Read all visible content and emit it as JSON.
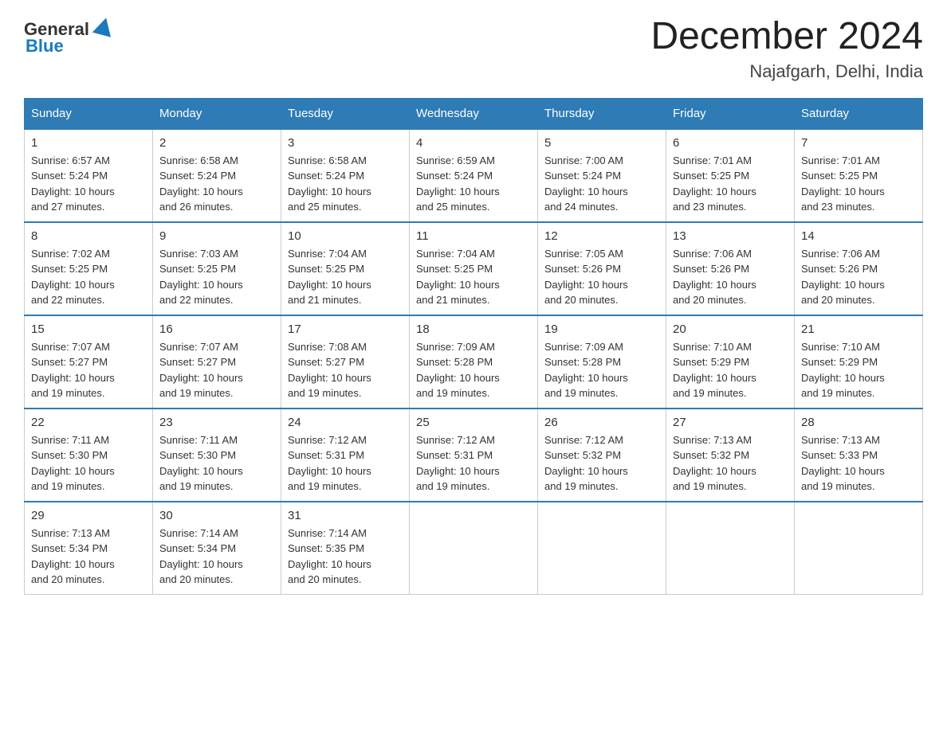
{
  "header": {
    "logo_general": "General",
    "logo_blue": "Blue",
    "month_title": "December 2024",
    "location": "Najafgarh, Delhi, India"
  },
  "days_of_week": [
    "Sunday",
    "Monday",
    "Tuesday",
    "Wednesday",
    "Thursday",
    "Friday",
    "Saturday"
  ],
  "weeks": [
    [
      {
        "num": "1",
        "sunrise": "6:57 AM",
        "sunset": "5:24 PM",
        "daylight": "10 hours and 27 minutes."
      },
      {
        "num": "2",
        "sunrise": "6:58 AM",
        "sunset": "5:24 PM",
        "daylight": "10 hours and 26 minutes."
      },
      {
        "num": "3",
        "sunrise": "6:58 AM",
        "sunset": "5:24 PM",
        "daylight": "10 hours and 25 minutes."
      },
      {
        "num": "4",
        "sunrise": "6:59 AM",
        "sunset": "5:24 PM",
        "daylight": "10 hours and 25 minutes."
      },
      {
        "num": "5",
        "sunrise": "7:00 AM",
        "sunset": "5:24 PM",
        "daylight": "10 hours and 24 minutes."
      },
      {
        "num": "6",
        "sunrise": "7:01 AM",
        "sunset": "5:25 PM",
        "daylight": "10 hours and 23 minutes."
      },
      {
        "num": "7",
        "sunrise": "7:01 AM",
        "sunset": "5:25 PM",
        "daylight": "10 hours and 23 minutes."
      }
    ],
    [
      {
        "num": "8",
        "sunrise": "7:02 AM",
        "sunset": "5:25 PM",
        "daylight": "10 hours and 22 minutes."
      },
      {
        "num": "9",
        "sunrise": "7:03 AM",
        "sunset": "5:25 PM",
        "daylight": "10 hours and 22 minutes."
      },
      {
        "num": "10",
        "sunrise": "7:04 AM",
        "sunset": "5:25 PM",
        "daylight": "10 hours and 21 minutes."
      },
      {
        "num": "11",
        "sunrise": "7:04 AM",
        "sunset": "5:25 PM",
        "daylight": "10 hours and 21 minutes."
      },
      {
        "num": "12",
        "sunrise": "7:05 AM",
        "sunset": "5:26 PM",
        "daylight": "10 hours and 20 minutes."
      },
      {
        "num": "13",
        "sunrise": "7:06 AM",
        "sunset": "5:26 PM",
        "daylight": "10 hours and 20 minutes."
      },
      {
        "num": "14",
        "sunrise": "7:06 AM",
        "sunset": "5:26 PM",
        "daylight": "10 hours and 20 minutes."
      }
    ],
    [
      {
        "num": "15",
        "sunrise": "7:07 AM",
        "sunset": "5:27 PM",
        "daylight": "10 hours and 19 minutes."
      },
      {
        "num": "16",
        "sunrise": "7:07 AM",
        "sunset": "5:27 PM",
        "daylight": "10 hours and 19 minutes."
      },
      {
        "num": "17",
        "sunrise": "7:08 AM",
        "sunset": "5:27 PM",
        "daylight": "10 hours and 19 minutes."
      },
      {
        "num": "18",
        "sunrise": "7:09 AM",
        "sunset": "5:28 PM",
        "daylight": "10 hours and 19 minutes."
      },
      {
        "num": "19",
        "sunrise": "7:09 AM",
        "sunset": "5:28 PM",
        "daylight": "10 hours and 19 minutes."
      },
      {
        "num": "20",
        "sunrise": "7:10 AM",
        "sunset": "5:29 PM",
        "daylight": "10 hours and 19 minutes."
      },
      {
        "num": "21",
        "sunrise": "7:10 AM",
        "sunset": "5:29 PM",
        "daylight": "10 hours and 19 minutes."
      }
    ],
    [
      {
        "num": "22",
        "sunrise": "7:11 AM",
        "sunset": "5:30 PM",
        "daylight": "10 hours and 19 minutes."
      },
      {
        "num": "23",
        "sunrise": "7:11 AM",
        "sunset": "5:30 PM",
        "daylight": "10 hours and 19 minutes."
      },
      {
        "num": "24",
        "sunrise": "7:12 AM",
        "sunset": "5:31 PM",
        "daylight": "10 hours and 19 minutes."
      },
      {
        "num": "25",
        "sunrise": "7:12 AM",
        "sunset": "5:31 PM",
        "daylight": "10 hours and 19 minutes."
      },
      {
        "num": "26",
        "sunrise": "7:12 AM",
        "sunset": "5:32 PM",
        "daylight": "10 hours and 19 minutes."
      },
      {
        "num": "27",
        "sunrise": "7:13 AM",
        "sunset": "5:32 PM",
        "daylight": "10 hours and 19 minutes."
      },
      {
        "num": "28",
        "sunrise": "7:13 AM",
        "sunset": "5:33 PM",
        "daylight": "10 hours and 19 minutes."
      }
    ],
    [
      {
        "num": "29",
        "sunrise": "7:13 AM",
        "sunset": "5:34 PM",
        "daylight": "10 hours and 20 minutes."
      },
      {
        "num": "30",
        "sunrise": "7:14 AM",
        "sunset": "5:34 PM",
        "daylight": "10 hours and 20 minutes."
      },
      {
        "num": "31",
        "sunrise": "7:14 AM",
        "sunset": "5:35 PM",
        "daylight": "10 hours and 20 minutes."
      },
      null,
      null,
      null,
      null
    ]
  ],
  "labels": {
    "sunrise_prefix": "Sunrise: ",
    "sunset_prefix": "Sunset: ",
    "daylight_prefix": "Daylight: "
  }
}
